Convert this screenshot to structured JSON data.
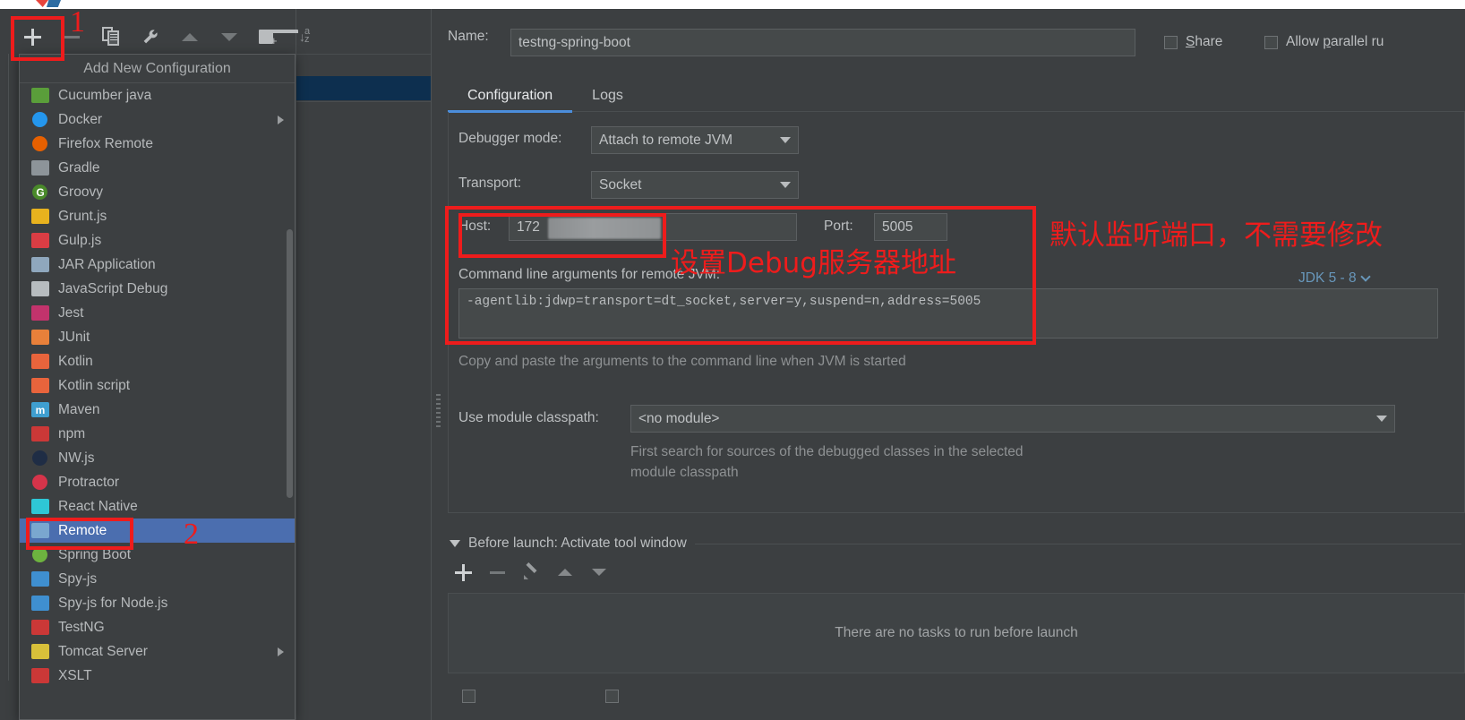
{
  "window": {
    "bg_color": "#3c3f41",
    "accent_color": "#4b8ddb",
    "annotation_color": "#ee1c1c",
    "selection_color": "#4b6eaf",
    "tree_selection_color": "#0d2f4f"
  },
  "toolbar": {
    "add_label": "+",
    "remove_label": "-",
    "items": [
      {
        "name": "add-configuration-button",
        "icon": "plus-icon"
      },
      {
        "name": "remove-configuration-button",
        "icon": "minus-icon"
      },
      {
        "name": "copy-configuration-button",
        "icon": "copy-icon"
      },
      {
        "name": "edit-templates-button",
        "icon": "wrench-icon"
      },
      {
        "name": "move-up-button",
        "icon": "triangle-up-icon"
      },
      {
        "name": "move-down-button",
        "icon": "triangle-down-icon"
      },
      {
        "name": "new-folder-button",
        "icon": "folder-add-icon"
      },
      {
        "name": "sort-configurations-button",
        "icon": "sort-az-icon"
      }
    ]
  },
  "popup": {
    "title": "Add New Configuration",
    "items": [
      {
        "label": "Cucumber java",
        "icon": "cucumber-icon",
        "color": "#5a9e3a",
        "glyph": "",
        "submenu": false
      },
      {
        "label": "Docker",
        "icon": "docker-icon",
        "color": "#2496ed",
        "glyph": "",
        "submenu": true
      },
      {
        "label": "Firefox Remote",
        "icon": "firefox-icon",
        "color": "#e66000",
        "glyph": "",
        "submenu": false
      },
      {
        "label": "Gradle",
        "icon": "gradle-icon",
        "color": "#8d9499",
        "glyph": "",
        "submenu": false
      },
      {
        "label": "Groovy",
        "icon": "groovy-icon",
        "color": "#4a8a2a",
        "glyph": "G",
        "submenu": false
      },
      {
        "label": "Grunt.js",
        "icon": "grunt-icon",
        "color": "#e8b21e",
        "glyph": "",
        "submenu": false
      },
      {
        "label": "Gulp.js",
        "icon": "gulp-icon",
        "color": "#da3d44",
        "glyph": "",
        "submenu": false
      },
      {
        "label": "JAR Application",
        "icon": "jar-application-icon",
        "color": "#8fa7bd",
        "glyph": "",
        "submenu": false
      },
      {
        "label": "JavaScript Debug",
        "icon": "javascript-debug-icon",
        "color": "#b7bcbf",
        "glyph": "",
        "submenu": false
      },
      {
        "label": "Jest",
        "icon": "jest-icon",
        "color": "#c2336c",
        "glyph": "",
        "submenu": false
      },
      {
        "label": "JUnit",
        "icon": "junit-icon",
        "color": "#e8803a",
        "glyph": "",
        "submenu": false
      },
      {
        "label": "Kotlin",
        "icon": "kotlin-icon",
        "color": "#e8643c",
        "glyph": "",
        "submenu": false
      },
      {
        "label": "Kotlin script",
        "icon": "kotlin-script-icon",
        "color": "#e8643c",
        "glyph": "",
        "submenu": false
      },
      {
        "label": "Maven",
        "icon": "maven-icon",
        "color": "#3f9fd0",
        "glyph": "m",
        "submenu": false
      },
      {
        "label": "npm",
        "icon": "npm-icon",
        "color": "#cb3837",
        "glyph": "",
        "submenu": false
      },
      {
        "label": "NW.js",
        "icon": "nwjs-icon",
        "color": "#1f2d45",
        "glyph": "",
        "submenu": false
      },
      {
        "label": "Protractor",
        "icon": "protractor-icon",
        "color": "#d6344a",
        "glyph": "",
        "submenu": false
      },
      {
        "label": "React Native",
        "icon": "react-native-icon",
        "color": "#2ec7d6",
        "glyph": "",
        "submenu": false
      },
      {
        "label": "Remote",
        "icon": "remote-icon",
        "color": "#7aa7cf",
        "glyph": "",
        "submenu": false,
        "selected": true
      },
      {
        "label": "Spring Boot",
        "icon": "spring-boot-icon",
        "color": "#6db33f",
        "glyph": "",
        "submenu": false
      },
      {
        "label": "Spy-js",
        "icon": "spy-js-icon",
        "color": "#3f8fd0",
        "glyph": "",
        "submenu": false
      },
      {
        "label": "Spy-js for Node.js",
        "icon": "spy-js-node-icon",
        "color": "#3f8fd0",
        "glyph": "",
        "submenu": false
      },
      {
        "label": "TestNG",
        "icon": "testng-icon",
        "color": "#cb3837",
        "glyph": "",
        "submenu": false
      },
      {
        "label": "Tomcat Server",
        "icon": "tomcat-icon",
        "color": "#d8c03a",
        "glyph": "",
        "submenu": true
      },
      {
        "label": "XSLT",
        "icon": "xslt-icon",
        "color": "#cb3837",
        "glyph": "",
        "submenu": false
      }
    ]
  },
  "form": {
    "name_label": "Name:",
    "name_value": "testng-spring-boot",
    "share_label": "Share",
    "share_checked": false,
    "allow_parallel_label": "Allow parallel ru",
    "allow_parallel_checked": false,
    "tabs": [
      {
        "label": "Configuration",
        "active": true
      },
      {
        "label": "Logs",
        "active": false
      }
    ],
    "debugger_mode_label": "Debugger mode:",
    "debugger_mode_value": "Attach to remote JVM",
    "transport_label": "Transport:",
    "transport_value": "Socket",
    "host_label": "Host:",
    "host_value": "172",
    "port_label": "Port:",
    "port_value": "5005",
    "cmdline_label": "Command line arguments for remote JVM:",
    "cmdline_value": "-agentlib:jdwp=transport=dt_socket,server=y,suspend=n,address=5005",
    "jdk_selector": "JDK 5 - 8",
    "copy_hint": "Copy and paste the arguments to the command line when JVM is started",
    "module_classpath_label": "Use module classpath:",
    "module_classpath_value": "<no module>",
    "module_hint_line1": "First search for sources of the debugged classes in the selected",
    "module_hint_line2": "module classpath"
  },
  "before_launch": {
    "header": "Before launch: Activate tool window",
    "empty_text": "There are no tasks to run before launch",
    "toolbar": [
      {
        "name": "add-task-button",
        "icon": "plus-icon"
      },
      {
        "name": "remove-task-button",
        "icon": "minus-icon"
      },
      {
        "name": "edit-task-button",
        "icon": "pencil-icon"
      },
      {
        "name": "move-task-up-button",
        "icon": "triangle-up-icon"
      },
      {
        "name": "move-task-down-button",
        "icon": "triangle-down-icon"
      }
    ]
  },
  "annotations": [
    {
      "name": "annotation-step-1",
      "text": "1"
    },
    {
      "name": "annotation-step-2",
      "text": "2"
    },
    {
      "name": "annotation-host-caption",
      "text": "设置Debug服务器地址"
    },
    {
      "name": "annotation-port-caption",
      "text": "默认监听端口，不需要修改"
    }
  ]
}
